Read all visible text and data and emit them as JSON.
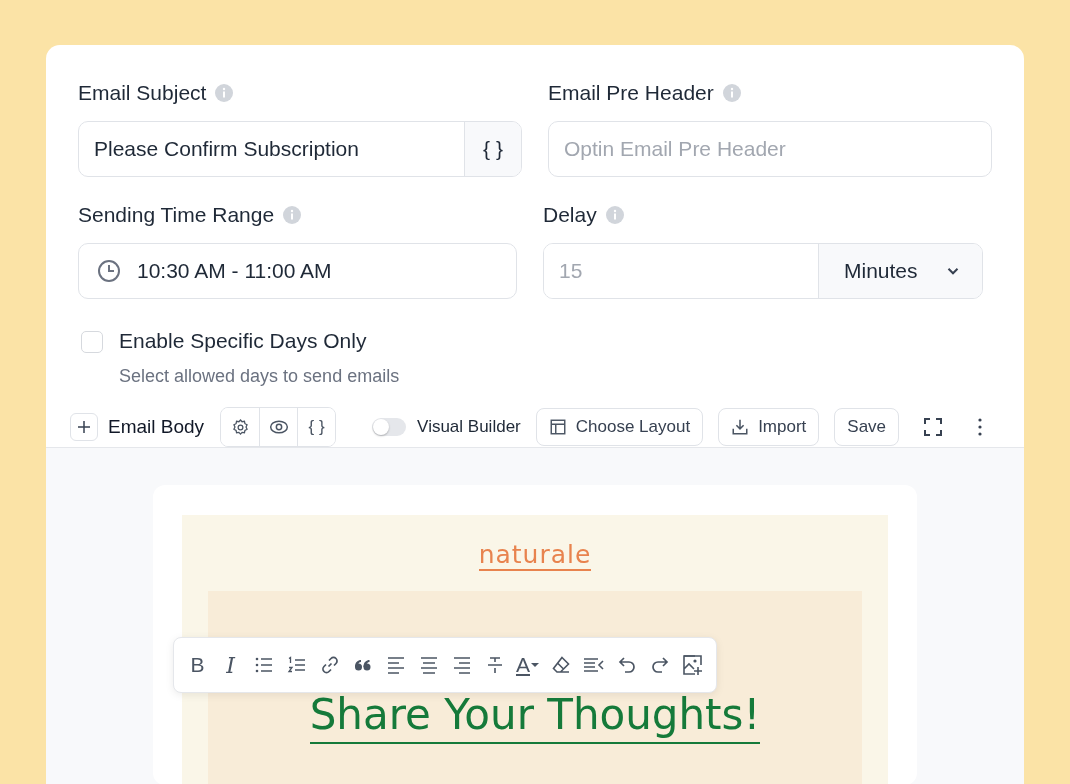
{
  "fields_row_1": [
    {
      "label": "Email Subject",
      "kind": "text-merge",
      "value": "Please Confirm Subscription",
      "addon": "{ }"
    },
    {
      "label": "Email Pre Header",
      "kind": "text",
      "placeholder": "Optin Email Pre Header"
    }
  ],
  "fields_row_2": [
    {
      "label": "Sending Time Range",
      "kind": "time",
      "value": "10:30 AM - 11:00 AM"
    },
    {
      "label": "Delay",
      "kind": "number-unit",
      "placeholder": "15",
      "unit": "Minutes"
    }
  ],
  "specific_days": {
    "label": "Enable Specific Days Only",
    "hint": "Select allowed days to send emails",
    "checked": false
  },
  "body_toolbar": {
    "title": "Email Body",
    "merge_tag": "{ }",
    "visual_builder": {
      "label": "Visual Builder",
      "on": false
    },
    "buttons": [
      {
        "label": "Choose Layout",
        "kind": "layout"
      },
      {
        "label": "Import",
        "kind": "import"
      },
      {
        "label": "Save",
        "kind": "plain"
      }
    ]
  },
  "email_preview": {
    "logo": "naturale",
    "heading": "Share Your Thoughts!"
  },
  "format_toolbar": [
    {
      "kind": "bold",
      "label": "B"
    },
    {
      "kind": "italic",
      "label": "I"
    },
    {
      "kind": "bullets"
    },
    {
      "kind": "numbers"
    },
    {
      "kind": "link"
    },
    {
      "kind": "quote"
    },
    {
      "kind": "align-left"
    },
    {
      "kind": "align-center"
    },
    {
      "kind": "align-right"
    },
    {
      "kind": "strike"
    },
    {
      "kind": "color",
      "label": "A"
    },
    {
      "kind": "eraser"
    },
    {
      "kind": "indent"
    },
    {
      "kind": "undo"
    },
    {
      "kind": "redo"
    },
    {
      "kind": "image"
    }
  ]
}
